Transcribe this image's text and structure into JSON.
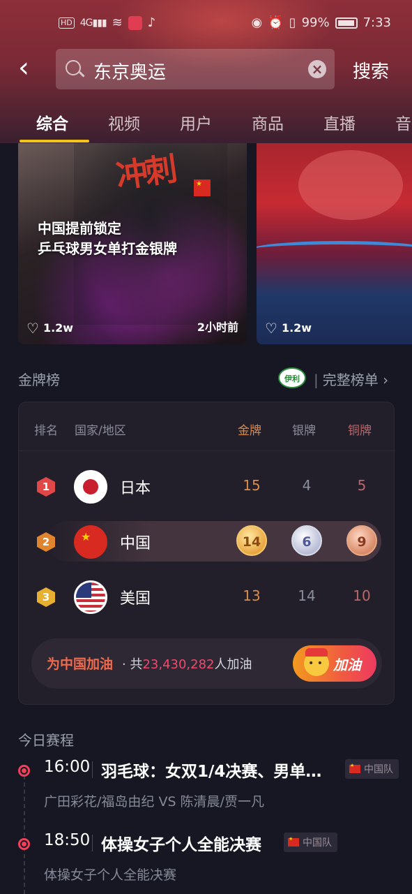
{
  "status": {
    "hd": "HD",
    "net": "4G",
    "battery": "99%",
    "time": "7:33"
  },
  "search": {
    "query": "东京奥运",
    "button": "搜索"
  },
  "tabs": [
    {
      "label": "综合",
      "active": true
    },
    {
      "label": "视频"
    },
    {
      "label": "用户"
    },
    {
      "label": "商品"
    },
    {
      "label": "直播"
    },
    {
      "label": "音"
    }
  ],
  "videos": [
    {
      "title_line1": "中国提前锁定",
      "title_line2": "乒乓球男女单打金银牌",
      "likes": "1.2w",
      "time_ago": "2小时前",
      "brush_text": "冲刺"
    },
    {
      "likes": "1.2w"
    }
  ],
  "medal_board": {
    "heading": "金牌榜",
    "sponsor": "伊利",
    "full_list": "完整榜单",
    "columns": {
      "rank": "排名",
      "country": "国家/地区",
      "gold": "金牌",
      "silver": "银牌",
      "bronze": "铜牌"
    },
    "rows": [
      {
        "rank": "1",
        "country": "日本",
        "gold": "15",
        "silver": "4",
        "bronze": "5"
      },
      {
        "rank": "2",
        "country": "中国",
        "gold": "14",
        "silver": "6",
        "bronze": "9"
      },
      {
        "rank": "3",
        "country": "美国",
        "gold": "13",
        "silver": "14",
        "bronze": "10"
      }
    ],
    "cheer": {
      "label": "为中国加油",
      "prefix": "· 共",
      "count": "23,430,282",
      "suffix": "人加油",
      "button": "加油"
    }
  },
  "schedule": {
    "heading": "今日赛程",
    "events": [
      {
        "time": "16:00",
        "title": "羽毛球：女双1/4决赛、男单…",
        "team": "中国队",
        "subtitle": "广田彩花/福岛由纪 VS 陈清晨/贾一凡"
      },
      {
        "time": "18:50",
        "title": "体操女子个人全能决赛",
        "team": "中国队",
        "subtitle": "体操女子个人全能决赛"
      }
    ]
  },
  "colors": {
    "accent_tab": "#f2c318",
    "gold": "#d98c4a",
    "bronze": "#b8686a",
    "cheer_red": "#f04a6c",
    "timeline_dot": "#f0405a"
  }
}
